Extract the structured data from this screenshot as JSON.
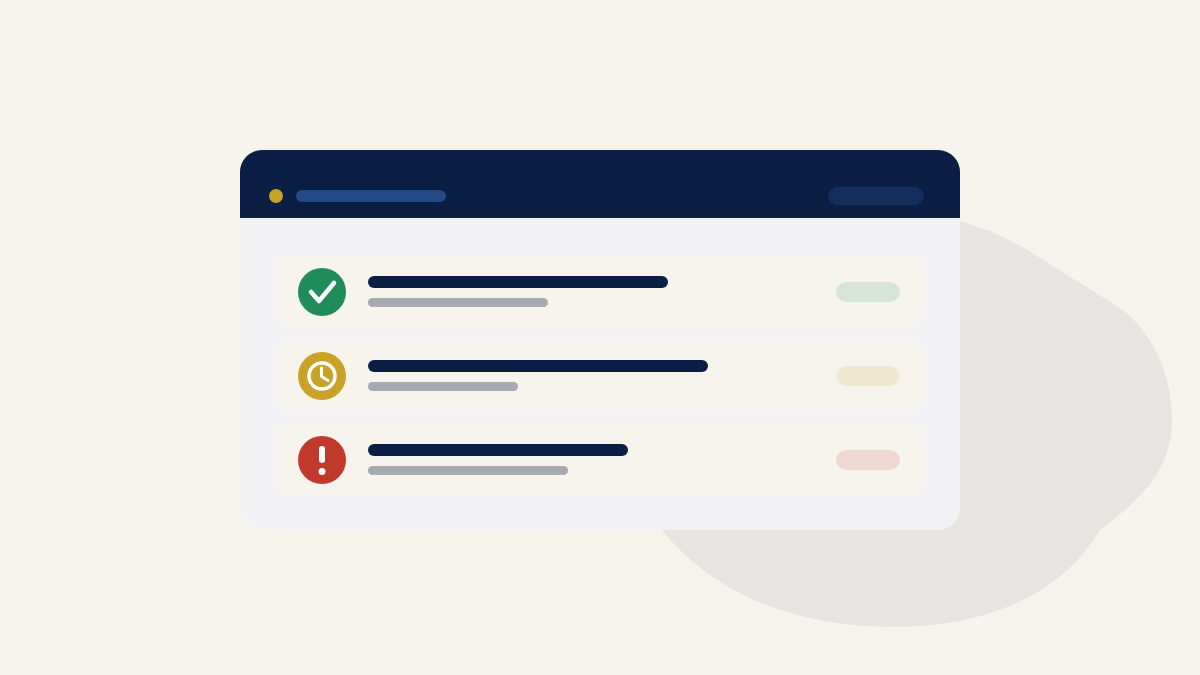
{
  "rows": [
    {
      "kind": "done",
      "color": "#1f8c5a"
    },
    {
      "kind": "pending",
      "color": "#c9a227"
    },
    {
      "kind": "alert",
      "color": "#c0392b"
    }
  ]
}
